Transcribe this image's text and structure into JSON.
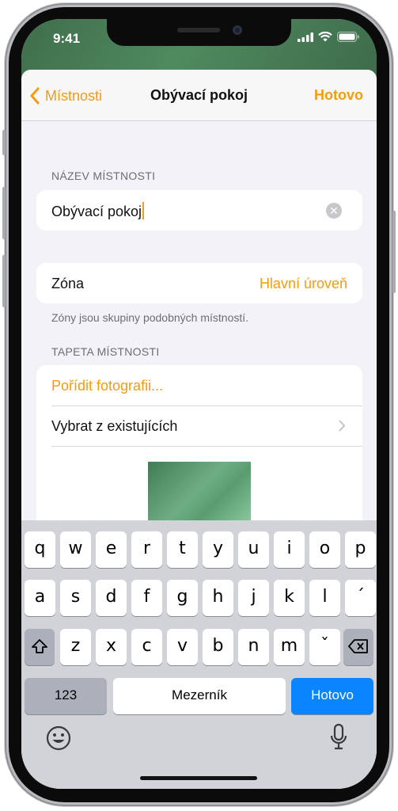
{
  "status": {
    "time": "9:41"
  },
  "nav": {
    "back_label": "Místnosti",
    "title": "Obývací pokoj",
    "done_label": "Hotovo"
  },
  "room_name": {
    "section_label": "NÁZEV MÍSTNOSTI",
    "value": "Obývací pokoj"
  },
  "zone": {
    "label": "Zóna",
    "value": "Hlavní úroveň",
    "footnote": "Zóny jsou skupiny podobných místností."
  },
  "wallpaper": {
    "section_label": "TAPETA MÍSTNOSTI",
    "take_photo": "Pořídit fotografii...",
    "choose_existing": "Vybrat z existujících"
  },
  "keyboard": {
    "row1": [
      "q",
      "w",
      "e",
      "r",
      "t",
      "y",
      "u",
      "i",
      "o",
      "p"
    ],
    "row2": [
      "a",
      "s",
      "d",
      "f",
      "g",
      "h",
      "j",
      "k",
      "l",
      "´"
    ],
    "row3": [
      "z",
      "x",
      "c",
      "v",
      "b",
      "n",
      "m",
      "ˇ"
    ],
    "numbers_label": "123",
    "space_label": "Mezerník",
    "return_label": "Hotovo"
  },
  "colors": {
    "accent": "#f39c12",
    "return_key": "#0a84ff"
  },
  "icons": [
    "chevron-left-icon",
    "clear-icon",
    "chevron-right-icon",
    "shift-icon",
    "backspace-icon",
    "emoji-icon",
    "microphone-icon",
    "signal-icon",
    "wifi-icon",
    "battery-icon"
  ]
}
